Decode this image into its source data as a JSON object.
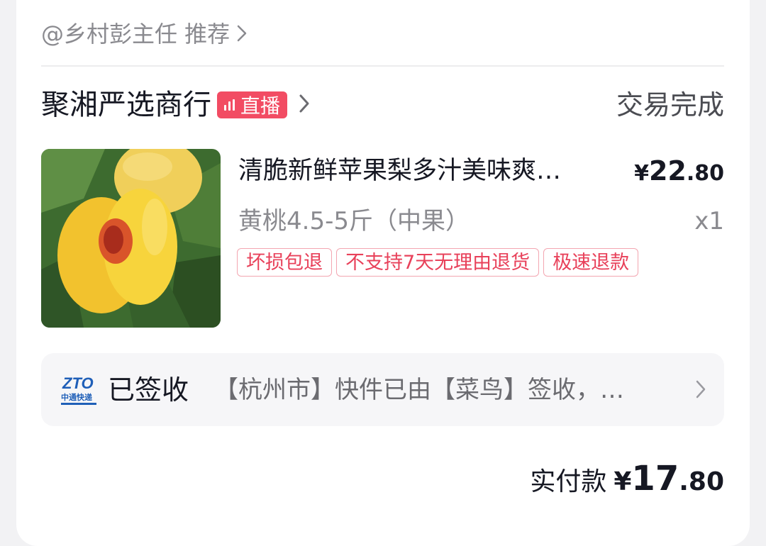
{
  "recommend": {
    "text": "@乡村彭主任 推荐",
    "chevron_icon": "chevron-right-icon"
  },
  "shop": {
    "name": "聚湘严选商行",
    "live_label": "直播",
    "status": "交易完成"
  },
  "product": {
    "title": "清脆新鲜苹果梨多汁美味爽…",
    "price_symbol": "¥",
    "price_int": "22",
    "price_dec": ".80",
    "spec": "黄桃4.5-5斤（中果）",
    "qty": "x1",
    "tags": [
      "坏损包退",
      "不支持7天无理由退货",
      "极速退款"
    ]
  },
  "logistics": {
    "carrier_icon": "zto-express-logo",
    "carrier_text": "中通快递",
    "status": "已签收",
    "detail": "【杭州市】快件已由【菜鸟】签收，…"
  },
  "payment": {
    "label": "实付款",
    "symbol": "¥",
    "int": "17",
    "dec": ".80"
  },
  "colors": {
    "accent": "#f24c63",
    "tag_text": "#e8415a",
    "text": "#161823",
    "muted": "#8a8a8f"
  }
}
